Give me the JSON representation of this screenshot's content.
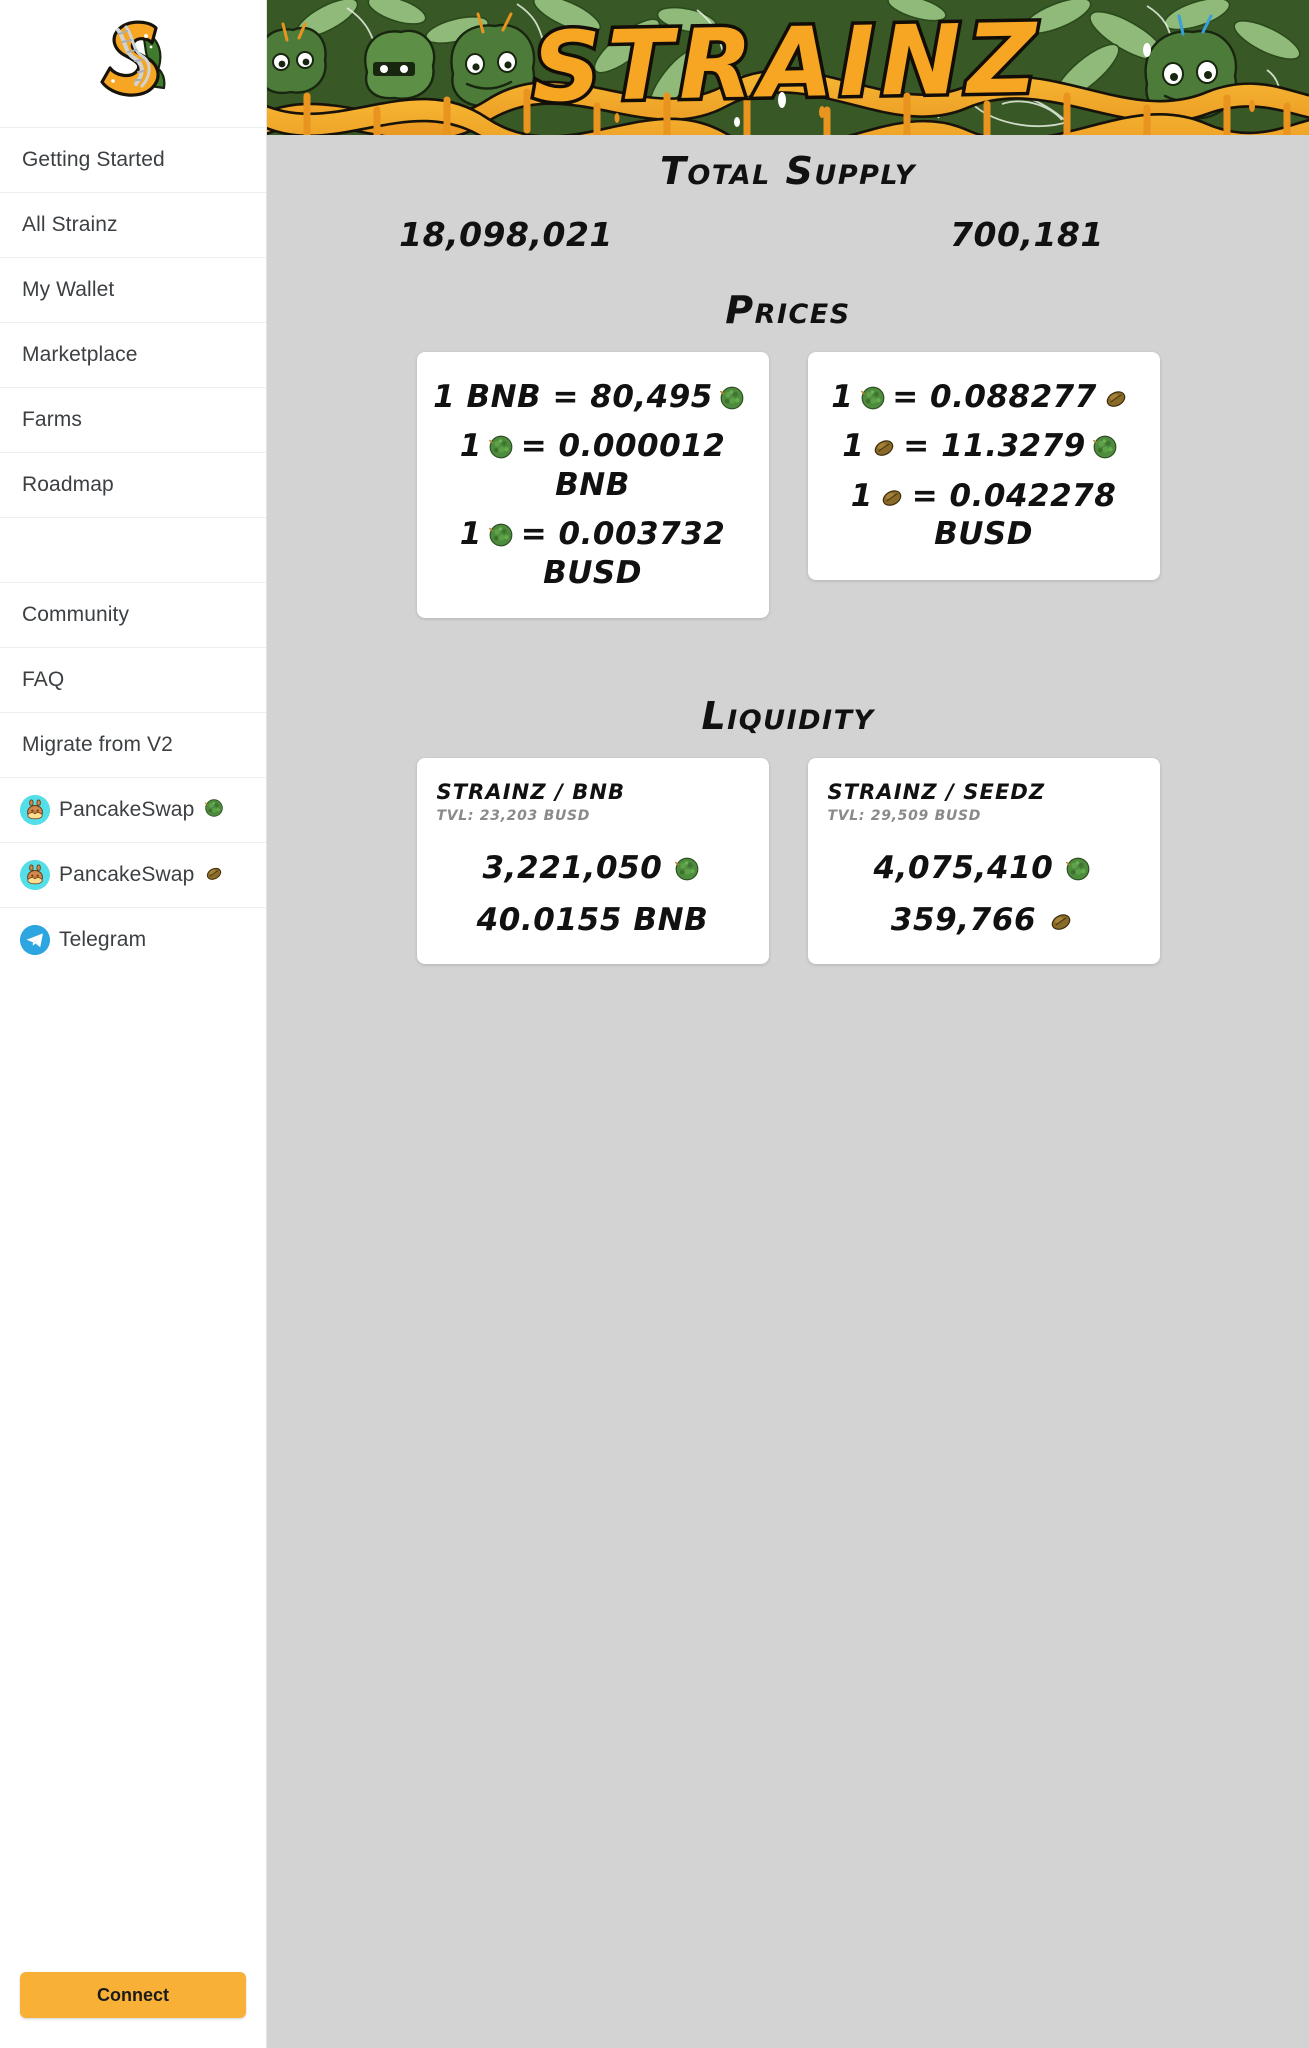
{
  "sidebar": {
    "logo_alt": "strainz-logo",
    "nav": [
      {
        "label": "Getting Started",
        "name": "sidebar-item-getting-started",
        "icon": null,
        "trailing": null
      },
      {
        "label": "All Strainz",
        "name": "sidebar-item-all-strainz",
        "icon": null,
        "trailing": null
      },
      {
        "label": "My Wallet",
        "name": "sidebar-item-my-wallet",
        "icon": null,
        "trailing": null
      },
      {
        "label": "Marketplace",
        "name": "sidebar-item-marketplace",
        "icon": null,
        "trailing": null
      },
      {
        "label": "Farms",
        "name": "sidebar-item-farms",
        "icon": null,
        "trailing": null
      },
      {
        "label": "Roadmap",
        "name": "sidebar-item-roadmap",
        "icon": null,
        "trailing": null
      },
      {
        "label": "",
        "name": "sidebar-spacer",
        "icon": null,
        "trailing": null
      },
      {
        "label": "Community",
        "name": "sidebar-item-community",
        "icon": null,
        "trailing": null
      },
      {
        "label": "FAQ",
        "name": "sidebar-item-faq",
        "icon": null,
        "trailing": null
      },
      {
        "label": "Migrate from V2",
        "name": "sidebar-item-migrate-from-v2",
        "icon": null,
        "trailing": null
      },
      {
        "label": "PancakeSwap",
        "name": "sidebar-item-pancakeswap-strainz",
        "icon": "pancakeswap-icon",
        "trailing": "bud"
      },
      {
        "label": "PancakeSwap",
        "name": "sidebar-item-pancakeswap-seedz",
        "icon": "pancakeswap-icon",
        "trailing": "seed"
      },
      {
        "label": "Telegram",
        "name": "sidebar-item-telegram",
        "icon": "telegram-icon",
        "trailing": null
      }
    ],
    "connect_label": "Connect"
  },
  "banner": {
    "wordmark": "STRAINZ"
  },
  "main": {
    "total_supply": {
      "title": "Total Supply",
      "strainz_amount": "18,098,021",
      "seedz_amount": "700,181"
    },
    "prices": {
      "title": "Prices",
      "cards": [
        {
          "name": "price-card-bnb",
          "lines": [
            {
              "prefix": "1 BNB = 80,495",
              "icon": "bud",
              "suffix": ""
            },
            {
              "prefix": "1",
              "icon": "bud",
              "suffix": "= 0.000012 BNB"
            },
            {
              "prefix": "1",
              "icon": "bud",
              "suffix": "= 0.003732 BUSD"
            }
          ]
        },
        {
          "name": "price-card-seedz",
          "lines": [
            {
              "prefix": "1",
              "icon": "bud",
              "suffix": "= 0.088277",
              "icon2": "seed"
            },
            {
              "prefix": "1",
              "icon": "seed",
              "suffix": "= 11.3279",
              "icon2": "bud"
            },
            {
              "prefix": "1",
              "icon": "seed",
              "suffix": "= 0.042278 BUSD"
            }
          ]
        }
      ]
    },
    "liquidity": {
      "title": "Liquidity",
      "cards": [
        {
          "name": "liquidity-card-strainz-bnb",
          "pair": "STRAINZ / BNB",
          "tvl": "TVL: 23,203 BUSD",
          "amount1": "3,221,050",
          "amount1_icon": "bud",
          "amount2": "40.0155 BNB",
          "amount2_icon": null
        },
        {
          "name": "liquidity-card-strainz-seedz",
          "pair": "STRAINZ / SEEDZ",
          "tvl": "TVL: 29,509 BUSD",
          "amount1": "4,075,410",
          "amount1_icon": "bud",
          "amount2": "359,766",
          "amount2_icon": "seed"
        }
      ]
    }
  },
  "colors": {
    "accent": "#F9B036",
    "banner_green": "#2f5124",
    "page_bg": "#d3d3d3",
    "sidebar_bg": "#ffffff",
    "bud_green": "#4e8c3d",
    "seed_brown": "#8a6a28",
    "telegram_blue": "#2CA5E0",
    "pancakeswap_cyan": "#53DEE9"
  }
}
